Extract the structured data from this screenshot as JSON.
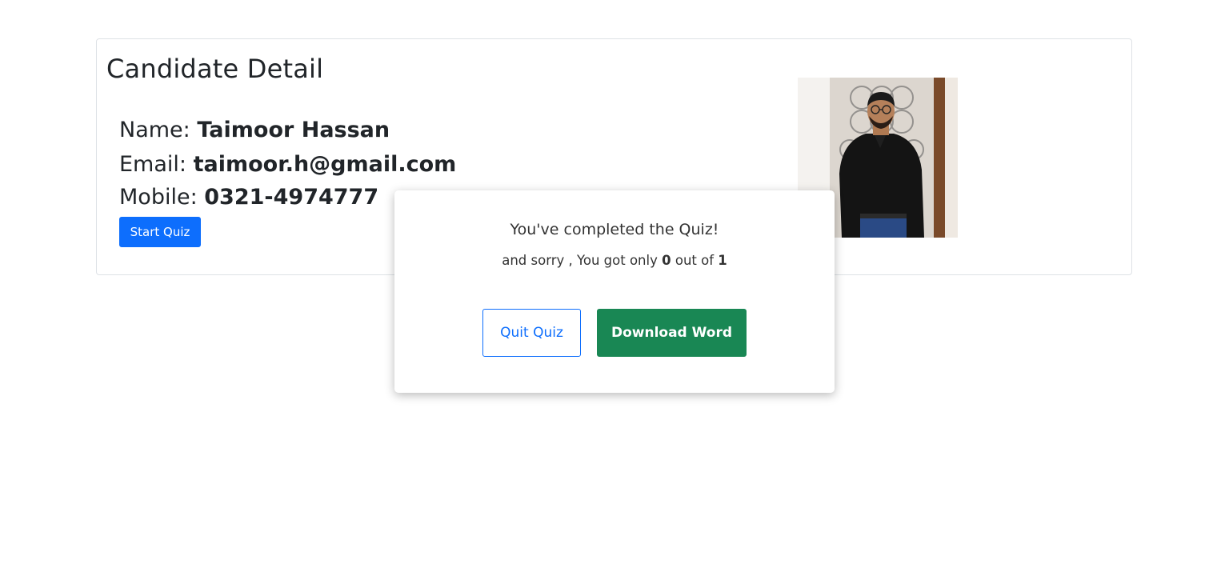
{
  "card": {
    "title": "Candidate Detail",
    "name_label": "Name:",
    "name_value": "Taimoor Hassan",
    "email_label": "Email:",
    "email_value": "taimoor.h@gmail.com",
    "mobile_label": "Mobile:",
    "mobile_value": "0321-4974777",
    "start_label": "Start Quiz"
  },
  "modal": {
    "title": "You've completed the Quiz!",
    "msg_prefix": "and sorry , You got only",
    "score": "0",
    "msg_middle": "out of",
    "total": "1",
    "quit_label": "Quit Quiz",
    "download_label": "Download Word"
  },
  "colors": {
    "primary": "#0d6efd",
    "success": "#198754"
  }
}
